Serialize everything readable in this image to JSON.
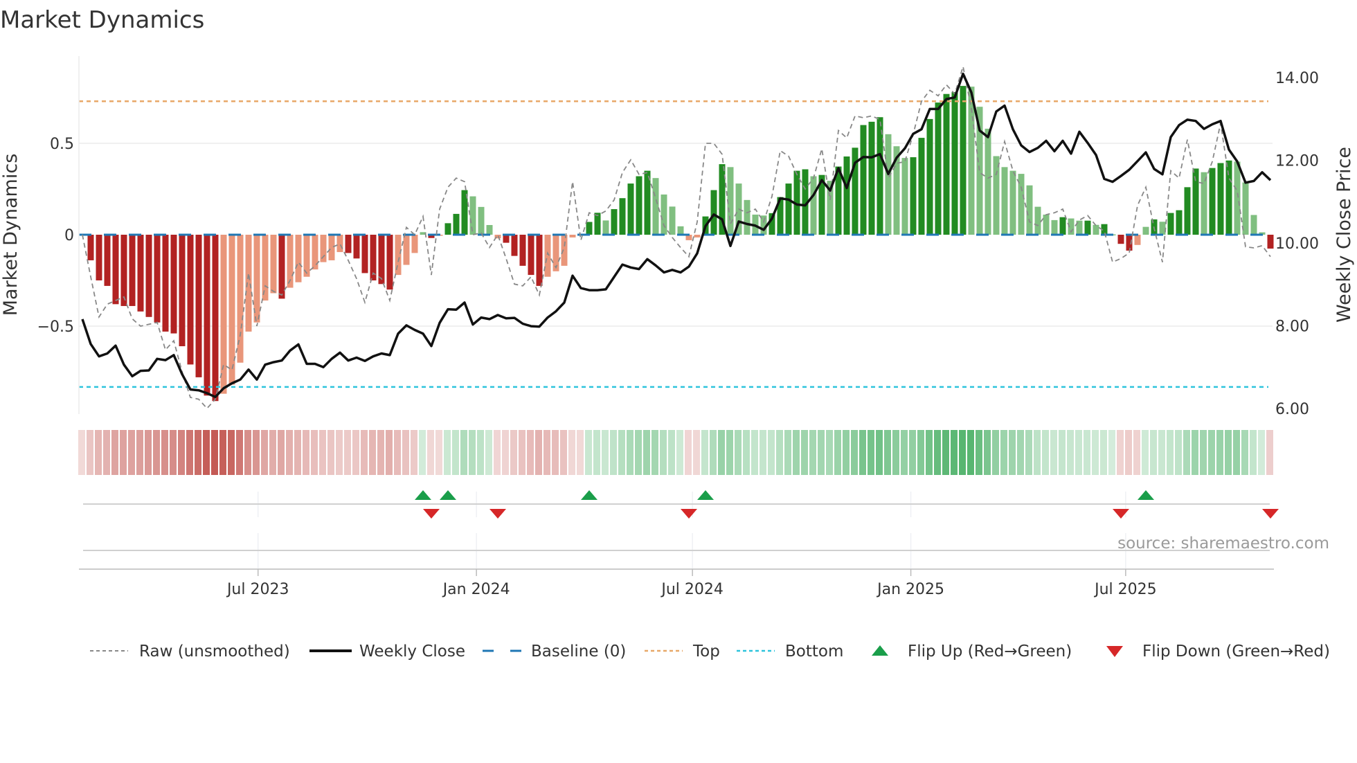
{
  "title": "Market Dynamics",
  "source": "source: sharemaestro.com",
  "colors": {
    "pos_strong": "#228b22",
    "pos_weak": "#80bf80",
    "neg_strong": "#b22222",
    "neg_weak": "#e9967a",
    "close_line": "#111111",
    "raw_line": "#888888",
    "baseline": "#1f77b4",
    "top": "#e8a868",
    "bottom": "#2ec4dc",
    "flip_up": "#1a9e4a",
    "flip_down": "#d62728",
    "heat_pos": "#3daa5a",
    "heat_neg": "#c0504a"
  },
  "legend": [
    {
      "key": "raw",
      "label": "Raw (unsmoothed)"
    },
    {
      "key": "close",
      "label": "Weekly Close"
    },
    {
      "key": "baseline",
      "label": "Baseline (0)"
    },
    {
      "key": "top",
      "label": "Top"
    },
    {
      "key": "bottom",
      "label": "Bottom"
    },
    {
      "key": "flip_up",
      "label": "Flip Up (Red→Green)"
    },
    {
      "key": "flip_down",
      "label": "Flip Down (Green→Red)"
    }
  ],
  "chart_data": {
    "type": "bar+line",
    "title": "Market Dynamics",
    "x_start": "2023-02-03",
    "x_step_days": 7,
    "left_axis": {
      "label": "Market Dynamics",
      "ylim": [
        -0.98,
        0.98
      ],
      "ticks": [
        {
          "v": 0.5,
          "label": "0.5"
        },
        {
          "v": 0,
          "label": "0"
        },
        {
          "v": -0.5,
          "label": "−0.5"
        }
      ]
    },
    "right_axis": {
      "label": "Weekly Close Price",
      "ylim": [
        5.87,
        14.52
      ],
      "ticks": [
        {
          "v": 14,
          "label": "14.00"
        },
        {
          "v": 12,
          "label": "12.00"
        },
        {
          "v": 10,
          "label": "10.00"
        },
        {
          "v": 8,
          "label": "8.00"
        },
        {
          "v": 6,
          "label": "6.00"
        }
      ]
    },
    "x_ticks": [
      {
        "date": "2023-07-01",
        "label": "Jul 2023"
      },
      {
        "date": "2024-01-01",
        "label": "Jan 2024"
      },
      {
        "date": "2024-07-01",
        "label": "Jul 2024"
      },
      {
        "date": "2025-01-01",
        "label": "Jan 2025"
      },
      {
        "date": "2025-07-01",
        "label": "Jul 2025"
      }
    ],
    "grid": true,
    "legend_position": "bottom",
    "baseline": 0,
    "top_level": 0.73,
    "bottom_level": -0.833,
    "dynamics": [
      0,
      -0.14,
      -0.25,
      -0.28,
      -0.38,
      -0.39,
      -0.39,
      -0.42,
      -0.45,
      -0.48,
      -0.53,
      -0.54,
      -0.61,
      -0.71,
      -0.78,
      -0.88,
      -0.91,
      -0.87,
      -0.82,
      -0.7,
      -0.53,
      -0.48,
      -0.36,
      -0.32,
      -0.35,
      -0.29,
      -0.26,
      -0.23,
      -0.19,
      -0.15,
      -0.14,
      -0.095,
      -0.1,
      -0.13,
      -0.21,
      -0.25,
      -0.27,
      -0.3,
      -0.22,
      -0.165,
      -0.1,
      0.014,
      -0.018,
      -0.004,
      0.063,
      0.114,
      0.244,
      0.21,
      0.152,
      0.053,
      -0.02,
      -0.044,
      -0.116,
      -0.17,
      -0.22,
      -0.28,
      -0.23,
      -0.2,
      -0.17,
      -0.015,
      -0.003,
      0.07,
      0.12,
      0.078,
      0.14,
      0.2,
      0.28,
      0.32,
      0.35,
      0.31,
      0.22,
      0.154,
      0.046,
      -0.03,
      -0.015,
      0.1,
      0.244,
      0.386,
      0.37,
      0.28,
      0.19,
      0.11,
      0.105,
      0.118,
      0.206,
      0.28,
      0.35,
      0.358,
      0.32,
      0.327,
      0.295,
      0.373,
      0.428,
      0.476,
      0.6,
      0.618,
      0.643,
      0.55,
      0.484,
      0.42,
      0.424,
      0.53,
      0.633,
      0.723,
      0.77,
      0.78,
      0.814,
      0.81,
      0.7,
      0.58,
      0.43,
      0.37,
      0.35,
      0.333,
      0.27,
      0.153,
      0.11,
      0.08,
      0.096,
      0.089,
      0.077,
      0.077,
      0.054,
      0.058,
      0.002,
      -0.05,
      -0.087,
      -0.056,
      0.043,
      0.084,
      0.071,
      0.119,
      0.134,
      0.26,
      0.362,
      0.342,
      0.365,
      0.392,
      0.406,
      0.4,
      0.286,
      0.108,
      0.013,
      -0.076
    ],
    "raw": [
      0,
      -0.23,
      -0.45,
      -0.38,
      -0.36,
      -0.34,
      -0.46,
      -0.5,
      -0.49,
      -0.48,
      -0.63,
      -0.58,
      -0.75,
      -0.89,
      -0.9,
      -0.95,
      -0.9,
      -0.71,
      -0.74,
      -0.55,
      -0.21,
      -0.5,
      -0.28,
      -0.31,
      -0.33,
      -0.25,
      -0.15,
      -0.21,
      -0.17,
      -0.12,
      -0.07,
      -0.05,
      -0.14,
      -0.24,
      -0.37,
      -0.21,
      -0.24,
      -0.36,
      -0.15,
      0.04,
      0.0,
      0.1,
      -0.22,
      0.14,
      0.26,
      0.31,
      0.29,
      0.0,
      0.01,
      -0.07,
      0.0,
      -0.13,
      -0.27,
      -0.28,
      -0.23,
      -0.33,
      -0.1,
      -0.18,
      -0.07,
      0.29,
      -0.03,
      0.12,
      0.105,
      0.13,
      0.19,
      0.34,
      0.41,
      0.33,
      0.34,
      0.2,
      0.05,
      -0.015,
      -0.07,
      -0.12,
      0.07,
      0.5,
      0.5,
      0.44,
      0.06,
      0.14,
      0.12,
      0.14,
      0.07,
      0.21,
      0.46,
      0.43,
      0.33,
      0.25,
      0.31,
      0.47,
      0.19,
      0.57,
      0.53,
      0.65,
      0.64,
      0.65,
      0.63,
      0.31,
      0.39,
      0.4,
      0.55,
      0.73,
      0.79,
      0.76,
      0.82,
      0.77,
      0.92,
      0.69,
      0.34,
      0.31,
      0.33,
      0.51,
      0.35,
      0.26,
      0.07,
      0.05,
      0.11,
      0.12,
      0.14,
      0.016,
      0.08,
      0.105,
      0.05,
      0.02,
      -0.15,
      -0.13,
      -0.1,
      0.16,
      0.26,
      0.035,
      -0.15,
      0.35,
      0.31,
      0.52,
      0.29,
      0.28,
      0.4,
      0.61,
      0.31,
      0.24,
      -0.066,
      -0.072,
      -0.06,
      -0.12
    ],
    "weekly_close": [
      8.16,
      7.56,
      7.26,
      7.33,
      7.52,
      7.06,
      6.78,
      6.91,
      6.92,
      7.2,
      7.17,
      7.29,
      6.83,
      6.46,
      6.44,
      6.37,
      6.28,
      6.49,
      6.61,
      6.7,
      6.94,
      6.7,
      7.06,
      7.12,
      7.16,
      7.4,
      7.55,
      7.08,
      7.08,
      7.0,
      7.2,
      7.35,
      7.16,
      7.23,
      7.15,
      7.26,
      7.33,
      7.29,
      7.81,
      8.01,
      7.9,
      7.81,
      7.51,
      8.07,
      8.4,
      8.39,
      8.56,
      8.03,
      8.2,
      8.16,
      8.26,
      8.18,
      8.19,
      8.05,
      7.99,
      7.98,
      8.2,
      8.35,
      8.56,
      9.21,
      8.91,
      8.86,
      8.86,
      8.88,
      9.18,
      9.48,
      9.41,
      9.37,
      9.61,
      9.46,
      9.29,
      9.35,
      9.29,
      9.43,
      9.75,
      10.41,
      10.69,
      10.57,
      9.93,
      10.52,
      10.46,
      10.42,
      10.32,
      10.59,
      11.08,
      11.05,
      10.93,
      10.91,
      11.16,
      11.52,
      11.27,
      11.81,
      11.33,
      11.94,
      12.08,
      12.07,
      12.15,
      11.67,
      12.06,
      12.29,
      12.64,
      12.75,
      13.24,
      13.24,
      13.48,
      13.52,
      14.09,
      13.64,
      12.72,
      12.56,
      13.18,
      13.32,
      12.75,
      12.36,
      12.2,
      12.3,
      12.47,
      12.22,
      12.47,
      12.16,
      12.69,
      12.42,
      12.13,
      11.55,
      11.48,
      11.62,
      11.77,
      11.98,
      12.19,
      11.79,
      11.66,
      12.56,
      12.85,
      12.98,
      12.95,
      12.76,
      12.87,
      12.95,
      12.26,
      11.97,
      11.46,
      11.5,
      11.71,
      11.52
    ],
    "flip_up": [
      "2023-11-17",
      "2023-12-08",
      "2024-04-05",
      "2024-07-12",
      "2025-07-18"
    ],
    "flip_down": [
      "2023-11-24",
      "2024-01-19",
      "2024-06-28",
      "2025-06-27",
      "2025-10-31"
    ]
  }
}
